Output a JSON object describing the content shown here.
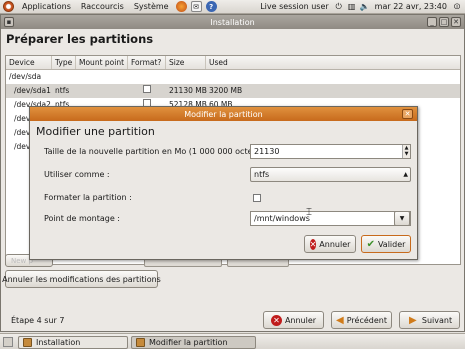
{
  "top_panel": {
    "menus": [
      "Applications",
      "Raccourcis",
      "Système"
    ],
    "session_label": "Live session user",
    "clock": "mar 22 avr, 23:40"
  },
  "window": {
    "title": "Installation",
    "page_title": "Préparer les partitions",
    "table": {
      "columns": [
        "Device",
        "Type",
        "Mount point",
        "Format?",
        "Size",
        "Used"
      ],
      "rows": [
        {
          "device": "/dev/sda",
          "type": "",
          "mount": "",
          "format": false,
          "size": "",
          "used": ""
        },
        {
          "device": "/dev/sda1",
          "type": "ntfs",
          "mount": "",
          "format": false,
          "size": "21130 MB",
          "used": "3200 MB"
        },
        {
          "device": "/dev/sda2",
          "type": "ntfs",
          "mount": "",
          "format": false,
          "size": "52128 MB",
          "used": "60 MB"
        },
        {
          "device": "/dev/",
          "type": "",
          "mount": "",
          "format": false,
          "size": "",
          "used": ""
        },
        {
          "device": "/dev/",
          "type": "",
          "mount": "",
          "format": false,
          "size": "",
          "used": ""
        },
        {
          "device": "/dev/",
          "type": "",
          "mount": "",
          "format": false,
          "size": "",
          "used": ""
        }
      ]
    },
    "hidden_button_label": "New p",
    "undo_button": "Annuler les modifications des partitions",
    "step_label": "Étape 4 sur 7",
    "cancel_button": "Annuler",
    "back_button": "Précédent",
    "forward_button": "Suivant"
  },
  "dialog": {
    "title": "Modifier la partition",
    "heading": "Modifier une partition",
    "size_label": "Taille de la nouvelle partition en Mo (1 000 000 octets)",
    "size_value": "21130",
    "use_as_label": "Utiliser comme :",
    "use_as_value": "ntfs",
    "format_label": "Formater la partition :",
    "format_checked": false,
    "mount_label": "Point de montage :",
    "mount_value": "/mnt/windows",
    "cancel_button": "Annuler",
    "ok_button": "Valider"
  },
  "taskbar": {
    "tasks": [
      "Installation",
      "Modifier la partition"
    ]
  },
  "colors": {
    "dialog_title": "#d77e2c",
    "cancel_icon": "#c01c1c",
    "arrow_icon": "#d07b1a"
  }
}
